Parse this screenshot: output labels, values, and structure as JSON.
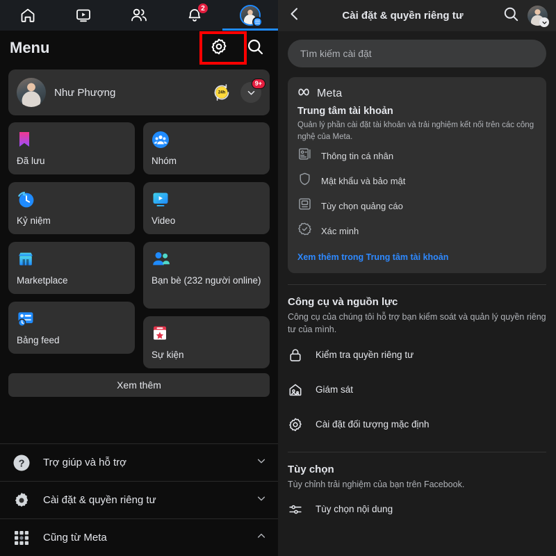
{
  "left": {
    "topnav": [
      {
        "name": "home-tab",
        "icon": "home-icon",
        "badge": ""
      },
      {
        "name": "video-tab",
        "icon": "video-icon",
        "badge": ""
      },
      {
        "name": "friends-tab",
        "icon": "friends-icon",
        "badge": ""
      },
      {
        "name": "notifications-tab",
        "icon": "bell-icon",
        "badge": "2"
      },
      {
        "name": "menu-tab",
        "icon": "avatar-icon",
        "badge": ""
      }
    ],
    "notifications_badge": "2",
    "header": {
      "title": "Menu",
      "gear_icon": "gear-icon",
      "search_icon": "search-icon"
    },
    "profile": {
      "name": "Như Phượng",
      "story_badge": "24h",
      "chevron_badge": "9+"
    },
    "tiles": [
      {
        "label": "Đã lưu",
        "icon": "bookmark-icon"
      },
      {
        "label": "Nhóm",
        "icon": "groups-icon"
      },
      {
        "label": "Kỷ niệm",
        "icon": "memories-clock-icon"
      },
      {
        "label": "Video",
        "icon": "video-play-icon"
      },
      {
        "label": "Marketplace",
        "icon": "marketplace-store-icon"
      },
      {
        "label": "Bạn bè (232 người online)",
        "icon": "friends-pair-icon"
      },
      {
        "label": "Bảng feed",
        "icon": "feeds-icon"
      },
      {
        "label": "Sự kiện",
        "icon": "calendar-star-icon"
      }
    ],
    "see_more": "Xem thêm",
    "list": [
      {
        "label": "Trợ giúp và hỗ trợ",
        "icon": "question-circle-icon",
        "chevron": "down"
      },
      {
        "label": "Cài đặt & quyền riêng tư",
        "icon": "gear-icon",
        "chevron": "down"
      },
      {
        "label": "Cũng từ Meta",
        "icon": "grid-apps-icon",
        "chevron": "up"
      }
    ]
  },
  "right": {
    "header": {
      "back_icon": "back-chevron-icon",
      "title": "Cài đặt & quyền riêng tư",
      "search_icon": "search-icon",
      "avatar_icon": "avatar-icon"
    },
    "search": {
      "placeholder": "Tìm kiếm cài đặt",
      "value": ""
    },
    "meta_card": {
      "brand": "Meta",
      "brand_icon": "meta-infinity-icon",
      "heading": "Trung tâm tài khoản",
      "description": "Quản lý phần cài đặt tài khoản và trải nghiệm kết nối trên các công nghệ của Meta.",
      "rows": [
        {
          "label": "Thông tin cá nhân",
          "icon": "id-card-icon",
          "highlighted": true
        },
        {
          "label": "Mật khẩu và bảo mật",
          "icon": "shield-icon",
          "highlighted": false
        },
        {
          "label": "Tùy chọn quảng cáo",
          "icon": "monitor-icon",
          "highlighted": false
        },
        {
          "label": "Xác minh",
          "icon": "verified-check-icon",
          "highlighted": false
        }
      ],
      "link": "Xem thêm trong Trung tâm tài khoản"
    },
    "sections": [
      {
        "title": "Công cụ và nguồn lực",
        "description": "Công cụ của chúng tôi hỗ trợ bạn kiểm soát và quản lý quyền riêng tư của mình.",
        "rows": [
          {
            "label": "Kiểm tra quyền riêng tư",
            "icon": "lock-icon"
          },
          {
            "label": "Giám sát",
            "icon": "supervision-home-icon"
          },
          {
            "label": "Cài đặt đối tượng mặc định",
            "icon": "gear-icon"
          }
        ]
      },
      {
        "title": "Tùy chọn",
        "description": "Tùy chỉnh trải nghiệm của bạn trên Facebook.",
        "rows": [
          {
            "label": "Tùy chọn nội dung",
            "icon": "sliders-icon"
          }
        ]
      }
    ]
  },
  "colors": {
    "accent_blue": "#1f8bff",
    "link_blue": "#2e89ff",
    "badge_red": "#e41e3f",
    "highlight_red": "#ff0000",
    "card_bg": "#303030",
    "left_bg": "#0d0d0d",
    "right_bg": "#1c1c1c"
  }
}
